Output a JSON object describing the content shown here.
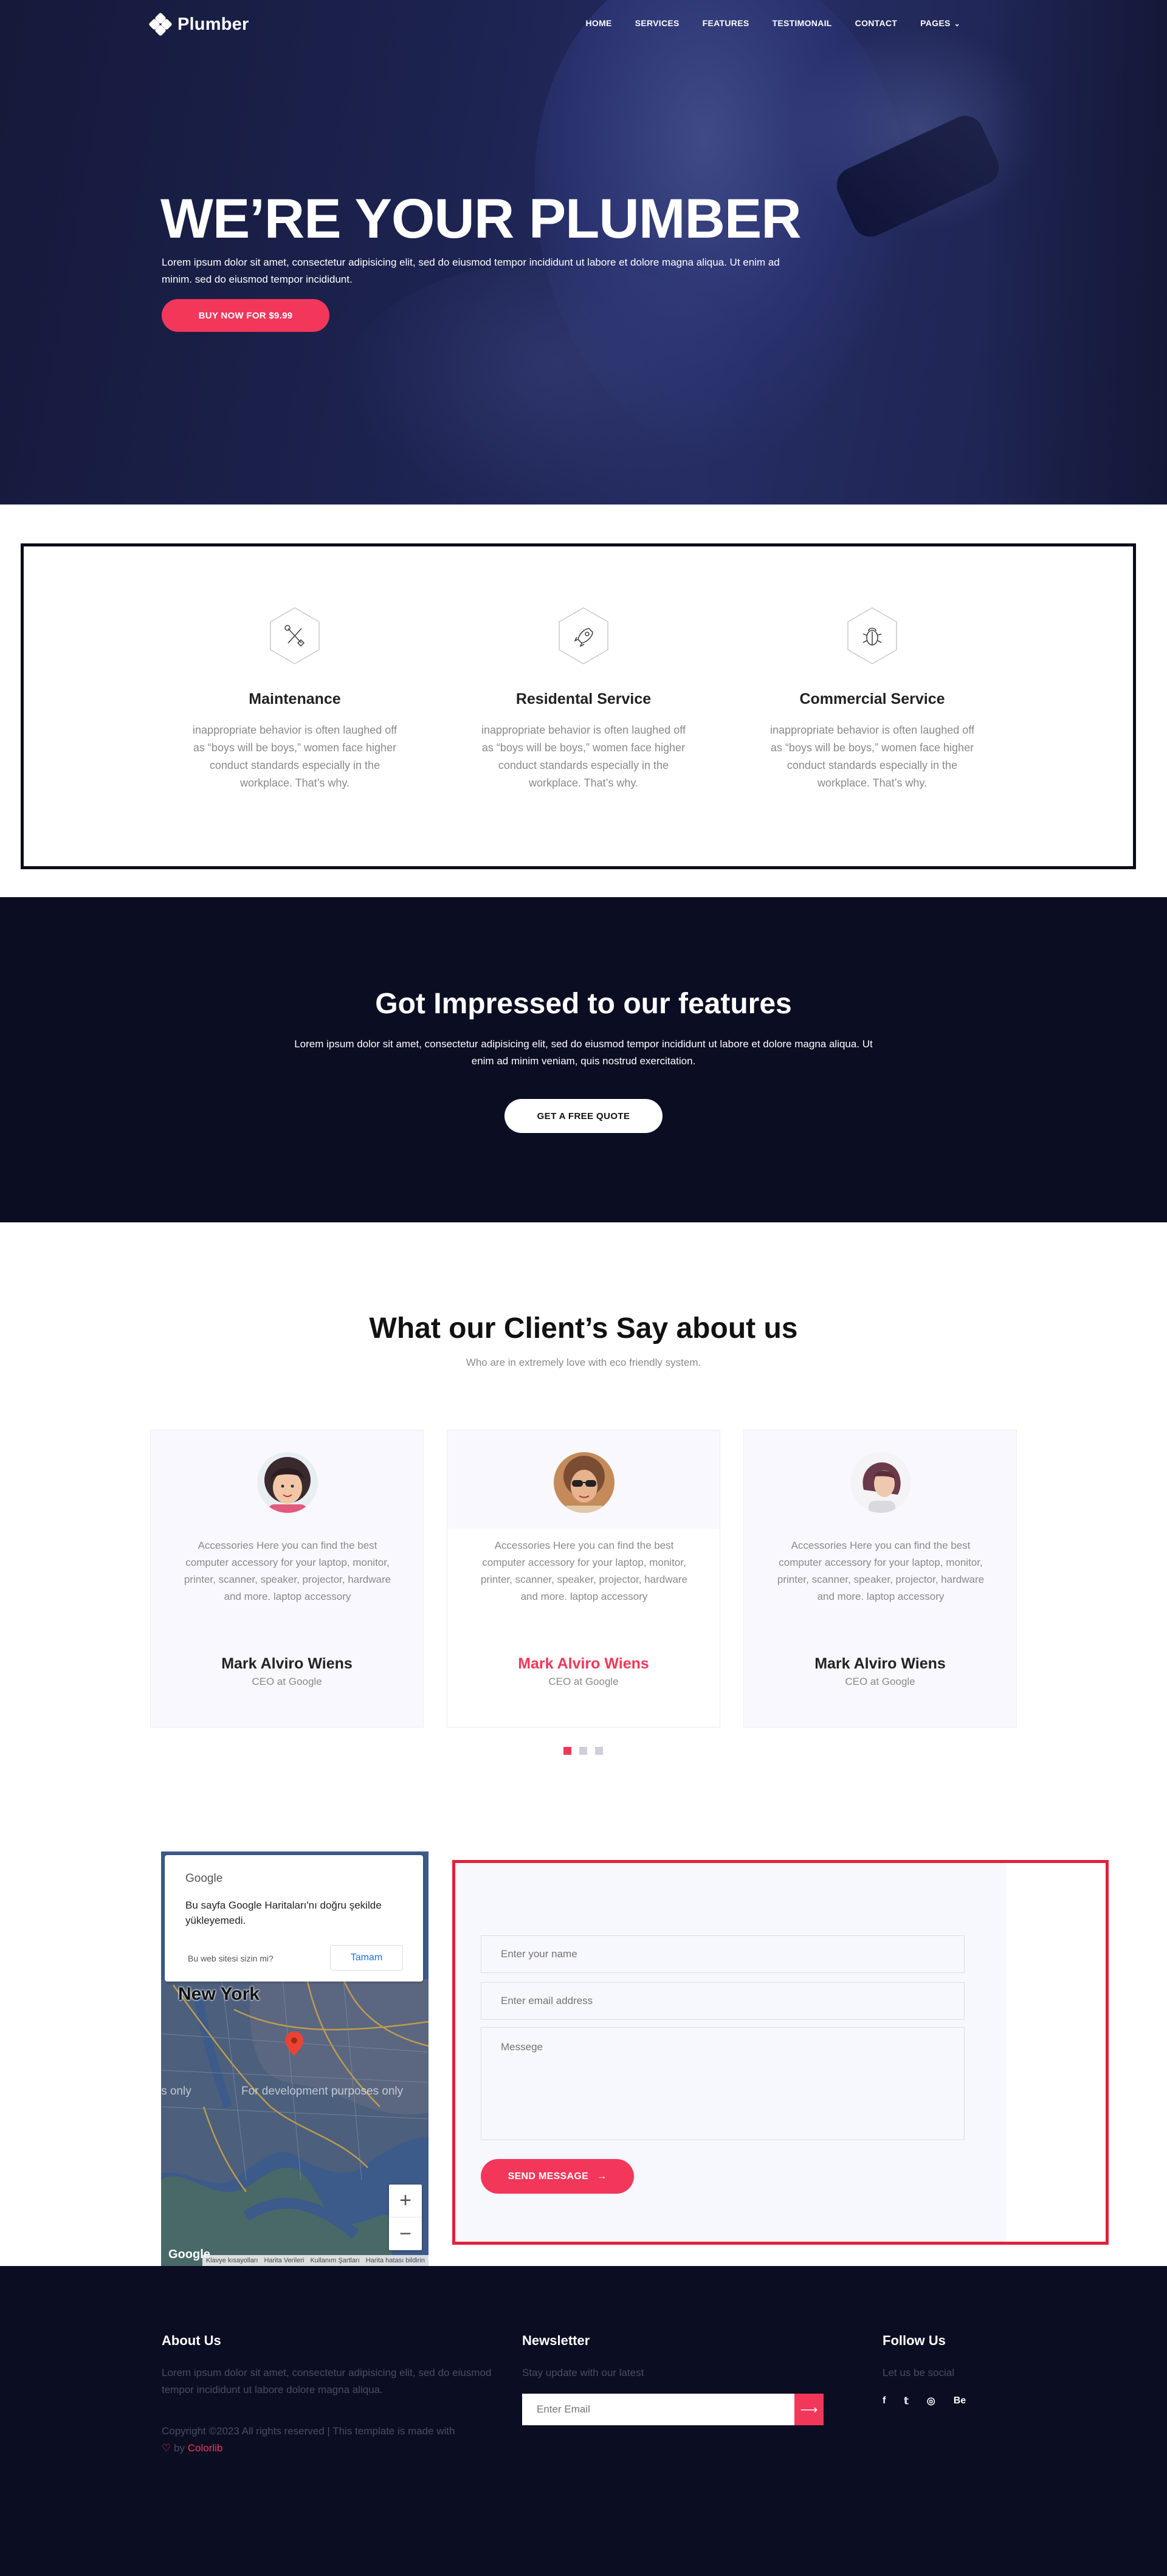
{
  "brand": {
    "name": "Plumber"
  },
  "nav": {
    "items": [
      "HOME",
      "SERVICES",
      "FEATURES",
      "TESTIMONAIL",
      "CONTACT",
      "PAGES"
    ]
  },
  "hero": {
    "title": "WE’RE YOUR PLUMBER",
    "text": "Lorem ipsum dolor sit amet, consectetur adipisicing elit, sed do eiusmod tempor incididunt ut labore et dolore magna aliqua. Ut enim ad minim. sed do eiusmod tempor incididunt.",
    "button": "BUY NOW FOR $9.99"
  },
  "features": [
    {
      "icon": "tools-icon",
      "title": "Maintenance",
      "text": "inappropriate behavior is often laughed off as “boys will be boys,” women face higher conduct standards especially in the workplace. That’s why."
    },
    {
      "icon": "rocket-icon",
      "title": "Residental Service",
      "text": "inappropriate behavior is often laughed off as “boys will be boys,” women face higher conduct standards especially in the workplace. That’s why."
    },
    {
      "icon": "bug-icon",
      "title": "Commercial Service",
      "text": "inappropriate behavior is often laughed off as “boys will be boys,” women face higher conduct standards especially in the workplace. That’s why."
    }
  ],
  "cta": {
    "title": "Got Impressed to our features",
    "text": "Lorem ipsum dolor sit amet, consectetur adipisicing elit, sed do eiusmod tempor incididunt ut labore et dolore magna aliqua. Ut enim ad minim veniam, quis nostrud exercitation.",
    "button": "GET A FREE QUOTE"
  },
  "testimonials": {
    "title": "What our Client’s Say about us",
    "subtitle": "Who are in extremely love with eco friendly system.",
    "cards": [
      {
        "quote": "Accessories Here you can find the best computer accessory for your laptop, monitor, printer, scanner, speaker, projector, hardware and more. laptop accessory",
        "name": "Mark Alviro Wiens",
        "role": "CEO at Google"
      },
      {
        "quote": "Accessories Here you can find the best computer accessory for your laptop, monitor, printer, scanner, speaker, projector, hardware and more. laptop accessory",
        "name": "Mark Alviro Wiens",
        "role": "CEO at Google"
      },
      {
        "quote": "Accessories Here you can find the best computer accessory for your laptop, monitor, printer, scanner, speaker, projector, hardware and more. laptop accessory",
        "name": "Mark Alviro Wiens",
        "role": "CEO at Google"
      }
    ],
    "active_page": 1,
    "page_count": 3
  },
  "map": {
    "brand": "Google",
    "message": "Bu sayfa Google Haritaları'nı doğru şekilde yükleyemedi.",
    "question": "Bu web sitesi sizin mi?",
    "ok_button": "Tamam",
    "city": "New York",
    "dev_text_left": "ses only",
    "dev_text_right": "For development purposes only",
    "zoom_in": "+",
    "zoom_out": "−",
    "logo": "Google",
    "attribution": [
      "Klavye kısayolları",
      "Harita Verileri",
      "Kullanım Şartları",
      "Harita hatası bildirin"
    ]
  },
  "contact_form": {
    "name_placeholder": "Enter your name",
    "email_placeholder": "Enter email address",
    "message_placeholder": "Messege",
    "send_button": "SEND MESSAGE"
  },
  "footer": {
    "about_title": "About Us",
    "about_text": "Lorem ipsum dolor sit amet, consectetur adipisicing elit, sed do eiusmod tempor incididunt ut labore dolore magna aliqua.",
    "copyright": "Copyright ©2023 All rights reserved | This template is made with",
    "copyright_by": "by",
    "copyright_link": "Colorlib",
    "newsletter_title": "Newsletter",
    "newsletter_text": "Stay update with our latest",
    "newsletter_placeholder": "Enter Email",
    "follow_title": "Follow Us",
    "follow_text": "Let us be social",
    "social": [
      "f",
      "t",
      "dribbble",
      "Be"
    ]
  },
  "colors": {
    "accent": "#f2375a",
    "dark": "#0b0d22",
    "map_water": "#3e5f8f"
  }
}
